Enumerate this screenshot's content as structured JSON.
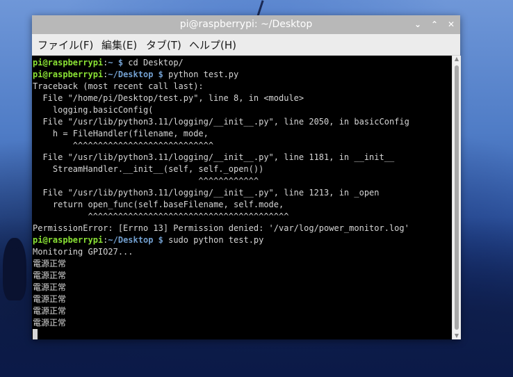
{
  "window": {
    "title": "pi@raspberrypi: ~/Desktop",
    "controls": {
      "minimize": "⌄",
      "maximize": "⌃",
      "close": "✕"
    }
  },
  "menu": [
    {
      "label": "ファイル(F)"
    },
    {
      "label": "編集(E)"
    },
    {
      "label": "タブ(T)"
    },
    {
      "label": "ヘルプ(H)"
    }
  ],
  "colors": {
    "prompt_user": "#8ae234",
    "prompt_dir": "#729fcf",
    "text": "#d6d6d6",
    "terminal_bg": "#000000"
  },
  "terminal": {
    "lines": [
      {
        "user": "pi@raspberrypi",
        "sep": ":",
        "dir": "~ $",
        "cmd": " cd Desktop/"
      },
      {
        "user": "pi@raspberrypi",
        "sep": ":",
        "dir": "~/Desktop $",
        "cmd": " python test.py"
      },
      {
        "text": "Traceback (most recent call last):"
      },
      {
        "text": "  File \"/home/pi/Desktop/test.py\", line 8, in <module>"
      },
      {
        "text": "    logging.basicConfig("
      },
      {
        "text": "  File \"/usr/lib/python3.11/logging/__init__.py\", line 2050, in basicConfig"
      },
      {
        "text": "    h = FileHandler(filename, mode,"
      },
      {
        "text": "        ^^^^^^^^^^^^^^^^^^^^^^^^^^^^"
      },
      {
        "text": "  File \"/usr/lib/python3.11/logging/__init__.py\", line 1181, in __init__"
      },
      {
        "text": "    StreamHandler.__init__(self, self._open())"
      },
      {
        "text": "                                 ^^^^^^^^^^^^"
      },
      {
        "text": "  File \"/usr/lib/python3.11/logging/__init__.py\", line 1213, in _open"
      },
      {
        "text": "    return open_func(self.baseFilename, self.mode,"
      },
      {
        "text": "           ^^^^^^^^^^^^^^^^^^^^^^^^^^^^^^^^^^^^^^^^"
      },
      {
        "text": "PermissionError: [Errno 13] Permission denied: '/var/log/power_monitor.log'"
      },
      {
        "user": "pi@raspberrypi",
        "sep": ":",
        "dir": "~/Desktop $",
        "cmd": " sudo python test.py"
      },
      {
        "text": "Monitoring GPIO27..."
      },
      {
        "text": "電源正常"
      },
      {
        "text": "電源正常"
      },
      {
        "text": "電源正常"
      },
      {
        "text": "電源正常"
      },
      {
        "text": "電源正常"
      },
      {
        "text": "電源正常"
      }
    ]
  }
}
